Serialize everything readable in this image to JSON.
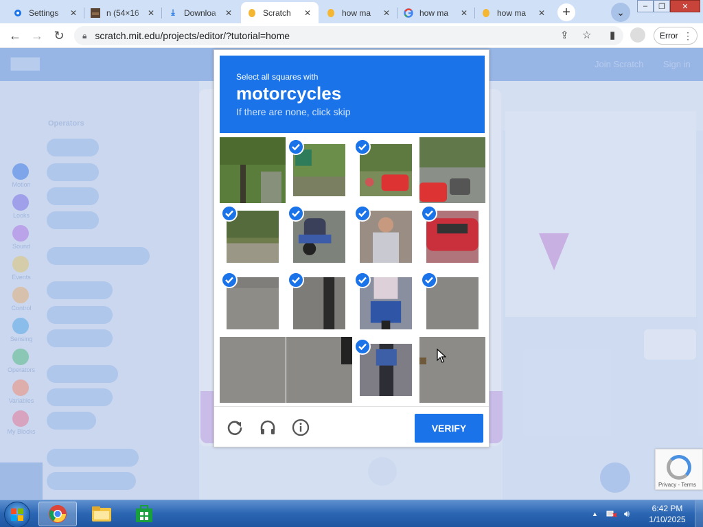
{
  "browser": {
    "tabs": [
      {
        "title": "Settings",
        "icon": "gear-icon",
        "active": false
      },
      {
        "title": "n (54×16",
        "icon": "image-icon",
        "active": false
      },
      {
        "title": "Downloa",
        "icon": "download-icon",
        "active": false
      },
      {
        "title": "Scratch",
        "icon": "scratch-cat-icon",
        "active": true
      },
      {
        "title": "how ma",
        "icon": "scratch-cat-icon",
        "active": false
      },
      {
        "title": "how ma",
        "icon": "google-icon",
        "active": false
      },
      {
        "title": "how ma",
        "icon": "scratch-cat-icon",
        "active": false
      }
    ],
    "url": "scratch.mit.edu/projects/editor/?tutorial=home",
    "profile_button": "Error"
  },
  "scratch": {
    "join_label": "Join Scratch",
    "signin_label": "Sign in",
    "categories": [
      "Motion",
      "Looks",
      "Sound",
      "Events",
      "Control",
      "Sensing",
      "Operators",
      "Variables",
      "My Blocks"
    ],
    "category_colors": [
      "#7fa8ef",
      "#a7a1ef",
      "#c7a6ee",
      "#e5d6a3",
      "#e8c9a6",
      "#8dc5ee",
      "#8dd1b0",
      "#efb3a6",
      "#e9a6bd"
    ],
    "palette_heading": "Operators"
  },
  "captcha": {
    "instruction": "Select all squares with",
    "target": "motorcycles",
    "hint": "If there are none, click skip",
    "verify_label": "VERIFY",
    "selected": [
      false,
      true,
      true,
      false,
      true,
      true,
      true,
      true,
      true,
      true,
      true,
      true,
      false,
      false,
      true,
      false
    ],
    "tile_colors": [
      "#5b7d3c",
      "#6b8f4a",
      "#7a8c5a",
      "#8a8f88",
      "#6f7d4d",
      "#7d837a",
      "#9a8e84",
      "#b0757a",
      "#8e8c86",
      "#7d7c78",
      "#8a8fa0",
      "#888783",
      "#8d8c88",
      "#8a8985",
      "#7e7d85",
      "#8c8b87"
    ],
    "badge_links": "Privacy - Terms"
  },
  "taskbar": {
    "time": "6:42 PM",
    "date": "1/10/2025"
  }
}
